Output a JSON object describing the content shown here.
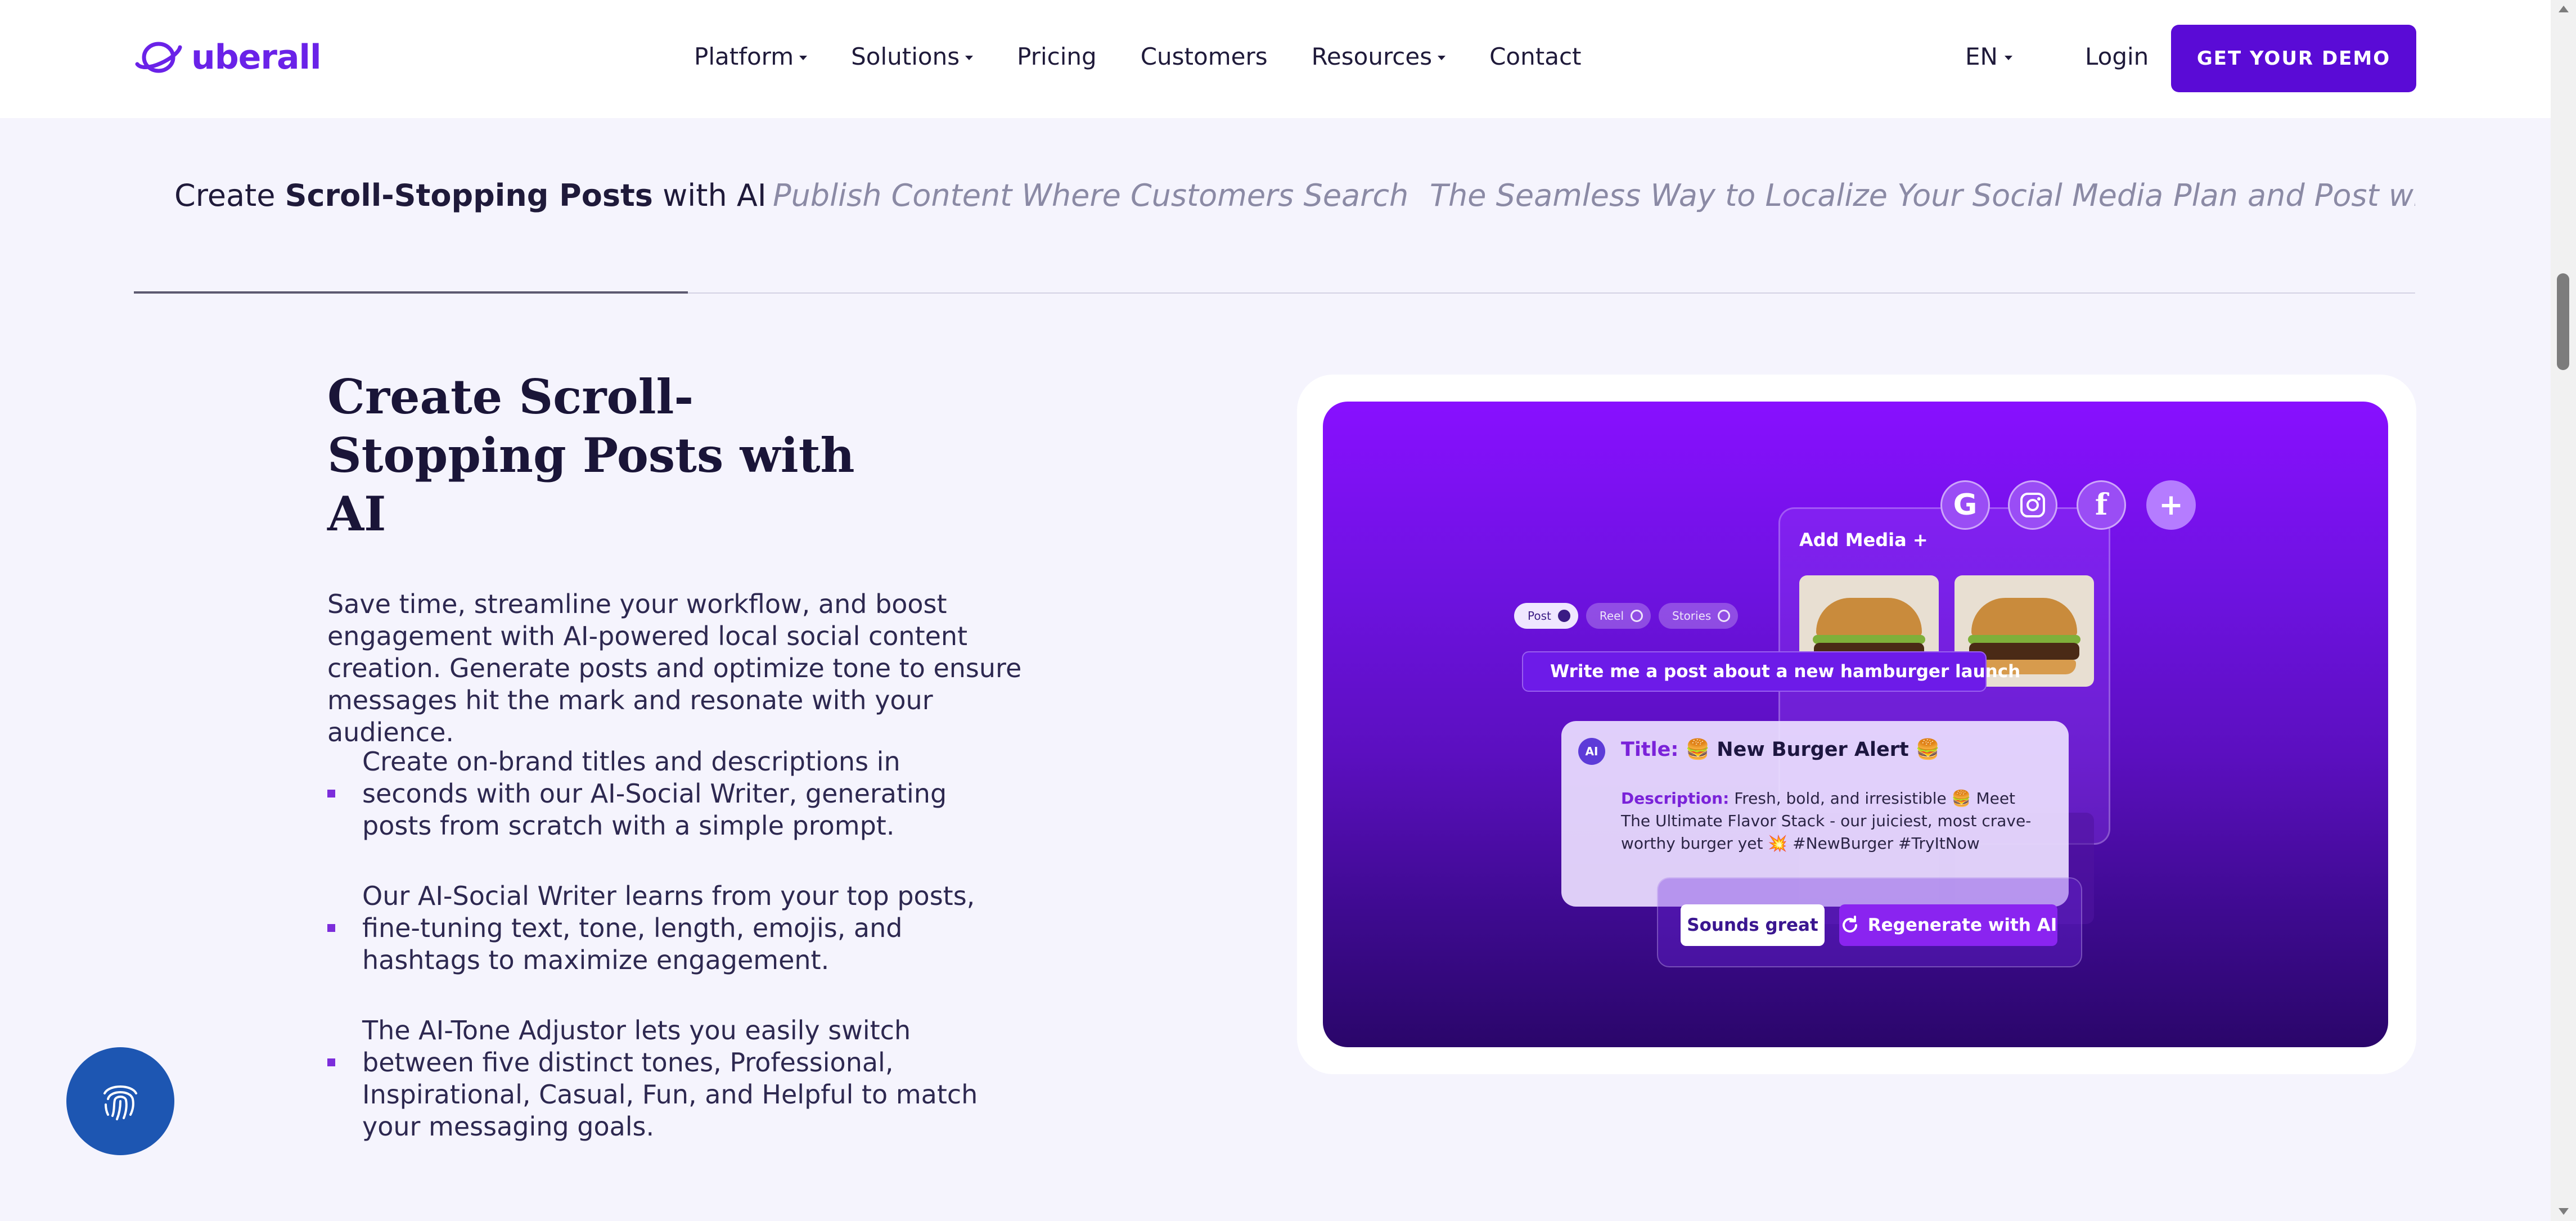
{
  "brand": {
    "name": "uberall",
    "color": "#6a22e8"
  },
  "nav": {
    "items": [
      {
        "label": "Platform",
        "dropdown": true
      },
      {
        "label": "Solutions",
        "dropdown": true
      },
      {
        "label": "Pricing",
        "dropdown": false
      },
      {
        "label": "Customers",
        "dropdown": false
      },
      {
        "label": "Resources",
        "dropdown": true
      },
      {
        "label": "Contact",
        "dropdown": false
      }
    ],
    "language": "EN",
    "login": "Login",
    "demo_button": "GET YOUR DEMO",
    "demo_button_color": "#5a0bd6"
  },
  "tabs": {
    "active": {
      "prefix": "Create ",
      "bold": "Scroll-Stopping Posts",
      "suffix": " with AI"
    },
    "inactive": [
      "Publish Content Where Customers Search",
      "The Seamless Way to Localize Your Social Media",
      "Plan and Post with"
    ]
  },
  "section": {
    "headline_line1": "Create Scroll-",
    "headline_line2": "Stopping Posts with AI",
    "intro": "Save time, streamline your workflow, and boost engagement with AI-powered local social content creation. Generate posts and optimize tone to ensure messages hit the mark and resonate with your audience.",
    "bullets": [
      "Create on-brand titles and descriptions in seconds with our AI-Social Writer, generating posts from scratch with a simple prompt.",
      "Our AI-Social Writer learns from your top posts, fine-tuning text, tone, length, emojis, and hashtags to maximize engagement.",
      "The AI-Tone Adjustor lets you easily switch between five distinct tones, Professional, Inspirational, Casual, Fun, and Helpful to match your messaging goals."
    ],
    "bullet_color": "#7c2ddb"
  },
  "promo": {
    "add_media": "Add Media +",
    "social_icons": [
      "google-icon",
      "instagram-icon",
      "facebook-icon",
      "plus-icon"
    ],
    "pills": [
      "Post",
      "Reel",
      "Stories"
    ],
    "prompt": "Write me a post about a new hamburger launch",
    "ai_badge": "AI",
    "title_label": "Title:",
    "title_value": "🍔 New Burger Alert 🍔",
    "description_label": "Description:",
    "description_value": "Fresh, bold, and irresistible 🍔 Meet The Ultimate Flavor Stack - our juiciest, most crave-worthy burger yet 💥 #NewBurger #TryItNow",
    "button_accept": "Sounds great",
    "button_regenerate": "Regenerate with AI",
    "gradient_top": "#8810ff",
    "gradient_bottom": "#2a066a"
  },
  "widget": {
    "icon": "fingerprint-icon",
    "color": "#1d56b2"
  }
}
